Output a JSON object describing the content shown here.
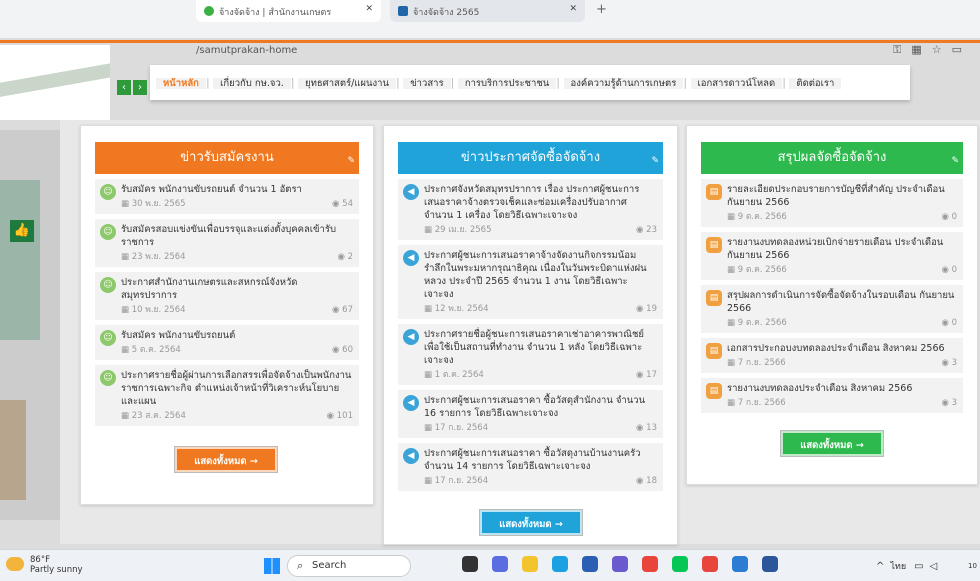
{
  "browser": {
    "tabs": [
      {
        "label": "จ้างจัดจ้าง | สำนักงานเกษตร",
        "active": true
      },
      {
        "label": "จ้างจัดจ้าง 2565",
        "active": false
      }
    ],
    "url": "/samutprakan-home"
  },
  "nav": {
    "items": [
      {
        "label": "หน้าหลัก"
      },
      {
        "label": "เกี่ยวกับ กษ.จว."
      },
      {
        "label": "ยุทธศาสตร์/แผนงาน"
      },
      {
        "label": "ข่าวสาร"
      },
      {
        "label": "การบริการประชาชน"
      },
      {
        "label": "องค์ความรู้ด้านการเกษตร"
      },
      {
        "label": "เอกสารดาวน์โหลด"
      },
      {
        "label": "ติดต่อเรา"
      }
    ]
  },
  "panels": [
    {
      "title": "ข่าวรับสมัครงาน",
      "accent": "#f07820",
      "more_label": "แสดงทั้งหมด →",
      "items": [
        {
          "title": "รับสมัคร พนักงานขับรถยนต์ จำนวน 1 อัตรา",
          "date": "30 พ.ย. 2565",
          "views": "54"
        },
        {
          "title": "รับสมัครสอบแข่งขันเพื่อบรรจุและแต่งตั้งบุคคลเข้ารับราชการ",
          "date": "23 พ.ย. 2564",
          "views": "2"
        },
        {
          "title": "ประกาศสำนักงานเกษตรและสหกรณ์จังหวัดสมุทรปราการ",
          "date": "10 พ.ย. 2564",
          "views": "67"
        },
        {
          "title": "รับสมัคร พนักงานขับรถยนต์",
          "date": "5 ต.ค. 2564",
          "views": "60"
        },
        {
          "title": "ประกาศรายชื่อผู้ผ่านการเลือกสรรเพื่อจัดจ้างเป็นพนักงานราชการเฉพาะกิจ ตำแหน่งเจ้าหน้าที่วิเคราะห์นโยบายและแผน",
          "date": "23 ส.ค. 2564",
          "views": "101"
        }
      ]
    },
    {
      "title": "ข่าวประกาศจัดซื้อจัดจ้าง",
      "accent": "#1fa3d8",
      "more_label": "แสดงทั้งหมด →",
      "items": [
        {
          "title": "ประกาศจังหวัดสมุทรปราการ เรื่อง ประกาศผู้ชนะการเสนอราคาจ้างตรวจเช็คและซ่อมเครื่องปรับอากาศ จำนวน 1 เครื่อง โดยวิธีเฉพาะเจาะจง",
          "date": "29 เม.ย. 2565",
          "views": "23"
        },
        {
          "title": "ประกาศผู้ชนะการเสนอราคาจ้างจัดงานกิจกรรมน้อมรำลึกในพระมหากรุณาธิคุณ เนื่องในวันพระบิดาแห่งฝนหลวง ประจำปี 2565 จำนวน 1 งาน โดยวิธีเฉพาะเจาะจง",
          "date": "12 พ.ย. 2564",
          "views": "19"
        },
        {
          "title": "ประกาศรายชื่อผู้ชนะการเสนอราคาเช่าอาคารพาณิชย์เพื่อใช้เป็นสถานที่ทำงาน จำนวน 1 หลัง โดยวิธีเฉพาะเจาะจง",
          "date": "1 ต.ค. 2564",
          "views": "17"
        },
        {
          "title": "ประกาศผู้ชนะการเสนอราคา ซื้อวัสดุสำนักงาน จำนวน 16 รายการ โดยวิธีเฉพาะเจาะจง",
          "date": "17 ก.ย. 2564",
          "views": "13"
        },
        {
          "title": "ประกาศผู้ชนะการเสนอราคา ซื้อวัสดุงานบ้านงานครัว จำนวน 14 รายการ โดยวิธีเฉพาะเจาะจง",
          "date": "17 ก.ย. 2564",
          "views": "18"
        }
      ]
    },
    {
      "title": "สรุปผลจัดซื้อจัดจ้าง",
      "accent": "#2db94d",
      "more_label": "แสดงทั้งหมด →",
      "items": [
        {
          "title": "รายละเอียดประกอบรายการบัญชีที่สำคัญ ประจำเดือน กันยายน 2566",
          "date": "9 ต.ค. 2566",
          "views": "0"
        },
        {
          "title": "รายงานงบทดลองหน่วยเบิกจ่ายรายเดือน ประจำเดือน กันยายน 2566",
          "date": "9 ต.ค. 2566",
          "views": "0"
        },
        {
          "title": "สรุปผลการดำเนินการจัดซื้อจัดจ้างในรอบเดือน กันยายน 2566",
          "date": "9 ต.ค. 2566",
          "views": "0"
        },
        {
          "title": "เอกสารประกอบงบทดลองประจำเดือน สิงหาคม 2566",
          "date": "7 ก.ย. 2566",
          "views": "3"
        },
        {
          "title": "รายงานงบทดลองประจำเดือน สิงหาคม 2566",
          "date": "7 ก.ย. 2566",
          "views": "3"
        }
      ]
    }
  ],
  "taskbar": {
    "weather_temp": "86°F",
    "weather_desc": "Partly sunny",
    "search_placeholder": "Search",
    "ime_label": "ไทย",
    "clock": "10"
  }
}
